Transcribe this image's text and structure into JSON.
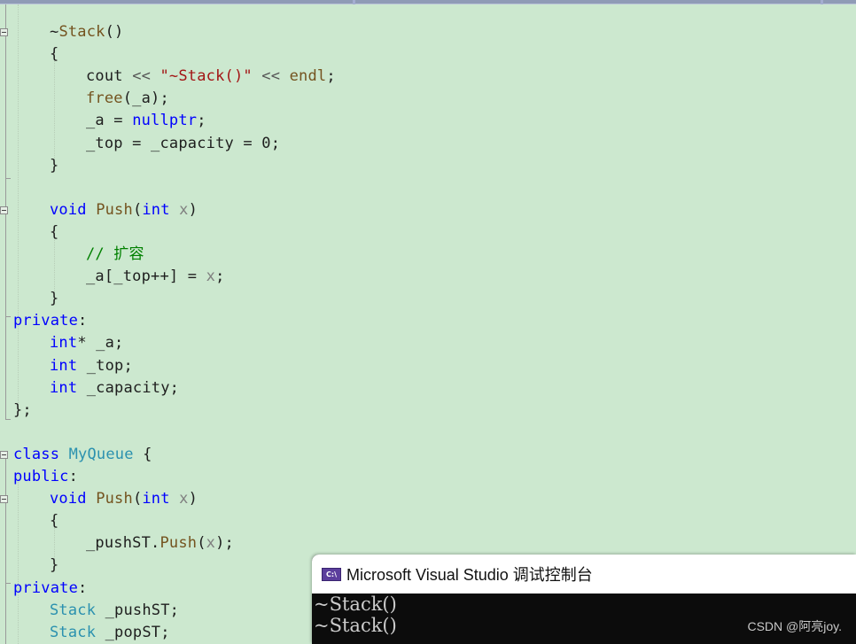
{
  "editor": {
    "background": "#cce8cf",
    "lines": [
      {
        "tokens": [
          {
            "t": "~",
            "c": ""
          },
          {
            "t": "Stack",
            "c": "fn"
          },
          {
            "t": "()",
            "c": ""
          }
        ]
      },
      {
        "tokens": [
          {
            "t": "{",
            "c": ""
          }
        ]
      },
      {
        "tokens": [
          {
            "t": "cout ",
            "c": ""
          },
          {
            "t": "<< ",
            "c": "op"
          },
          {
            "t": "\"~Stack()\"",
            "c": "str"
          },
          {
            "t": " << ",
            "c": "op"
          },
          {
            "t": "endl",
            "c": "fn"
          },
          {
            "t": ";",
            "c": ""
          }
        ]
      },
      {
        "tokens": [
          {
            "t": "free",
            "c": "fn"
          },
          {
            "t": "(_a);",
            "c": ""
          }
        ]
      },
      {
        "tokens": [
          {
            "t": "_a = ",
            "c": ""
          },
          {
            "t": "nullptr",
            "c": "kw"
          },
          {
            "t": ";",
            "c": ""
          }
        ]
      },
      {
        "tokens": [
          {
            "t": "_top = _capacity = 0;",
            "c": ""
          }
        ]
      },
      {
        "tokens": [
          {
            "t": "}",
            "c": ""
          }
        ]
      },
      {
        "tokens": []
      },
      {
        "tokens": [
          {
            "t": "void",
            "c": "kw"
          },
          {
            "t": " ",
            "c": ""
          },
          {
            "t": "Push",
            "c": "fn"
          },
          {
            "t": "(",
            "c": ""
          },
          {
            "t": "int",
            "c": "kw"
          },
          {
            "t": " ",
            "c": ""
          },
          {
            "t": "x",
            "c": "param"
          },
          {
            "t": ")",
            "c": ""
          }
        ]
      },
      {
        "tokens": [
          {
            "t": "{",
            "c": ""
          }
        ]
      },
      {
        "tokens": [
          {
            "t": "// 扩容",
            "c": "cm"
          }
        ]
      },
      {
        "tokens": [
          {
            "t": "_a[_top++] = ",
            "c": ""
          },
          {
            "t": "x",
            "c": "param"
          },
          {
            "t": ";",
            "c": ""
          }
        ]
      },
      {
        "tokens": [
          {
            "t": "}",
            "c": ""
          }
        ]
      },
      {
        "tokens": [
          {
            "t": "private",
            "c": "kw"
          },
          {
            "t": ":",
            "c": ""
          }
        ]
      },
      {
        "tokens": [
          {
            "t": "int",
            "c": "kw"
          },
          {
            "t": "* _a;",
            "c": ""
          }
        ]
      },
      {
        "tokens": [
          {
            "t": "int",
            "c": "kw"
          },
          {
            "t": " _top;",
            "c": ""
          }
        ]
      },
      {
        "tokens": [
          {
            "t": "int",
            "c": "kw"
          },
          {
            "t": " _capacity;",
            "c": ""
          }
        ]
      },
      {
        "tokens": [
          {
            "t": "};",
            "c": ""
          }
        ]
      },
      {
        "tokens": []
      },
      {
        "tokens": [
          {
            "t": "class",
            "c": "kw"
          },
          {
            "t": " ",
            "c": ""
          },
          {
            "t": "MyQueue",
            "c": "type"
          },
          {
            "t": " {",
            "c": ""
          }
        ]
      },
      {
        "tokens": [
          {
            "t": "public",
            "c": "kw"
          },
          {
            "t": ":",
            "c": ""
          }
        ]
      },
      {
        "tokens": [
          {
            "t": "void",
            "c": "kw"
          },
          {
            "t": " ",
            "c": ""
          },
          {
            "t": "Push",
            "c": "fn"
          },
          {
            "t": "(",
            "c": ""
          },
          {
            "t": "int",
            "c": "kw"
          },
          {
            "t": " ",
            "c": ""
          },
          {
            "t": "x",
            "c": "param"
          },
          {
            "t": ")",
            "c": ""
          }
        ]
      },
      {
        "tokens": [
          {
            "t": "{",
            "c": ""
          }
        ]
      },
      {
        "tokens": [
          {
            "t": "_pushST.",
            "c": ""
          },
          {
            "t": "Push",
            "c": "fn"
          },
          {
            "t": "(",
            "c": ""
          },
          {
            "t": "x",
            "c": "param"
          },
          {
            "t": ");",
            "c": ""
          }
        ]
      },
      {
        "tokens": [
          {
            "t": "}",
            "c": ""
          }
        ]
      },
      {
        "tokens": [
          {
            "t": "private",
            "c": "kw"
          },
          {
            "t": ":",
            "c": ""
          }
        ]
      },
      {
        "tokens": [
          {
            "t": "Stack",
            "c": "type"
          },
          {
            "t": " _pushST;",
            "c": ""
          }
        ]
      },
      {
        "tokens": [
          {
            "t": "Stack",
            "c": "type"
          },
          {
            "t": " _popST;",
            "c": ""
          }
        ]
      }
    ]
  },
  "console": {
    "title": "Microsoft Visual Studio 调试控制台",
    "icon_label": "C:\\",
    "icon_name": "console-app-icon",
    "output_lines": [
      "~Stack()",
      "~Stack()"
    ],
    "watermark": "CSDN @阿亮joy."
  }
}
